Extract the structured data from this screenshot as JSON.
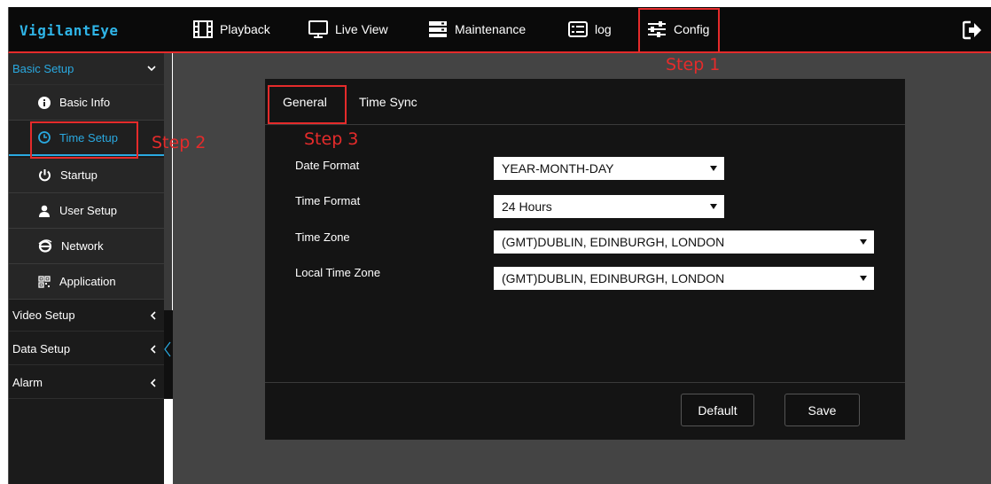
{
  "header": {
    "logo": "VigilantEye",
    "nav": [
      {
        "label": "Playback",
        "icon": "film-icon"
      },
      {
        "label": "Live View",
        "icon": "monitor-icon"
      },
      {
        "label": "Maintenance",
        "icon": "server-icon"
      },
      {
        "label": "log",
        "icon": "list-icon"
      },
      {
        "label": "Config",
        "icon": "sliders-icon"
      }
    ],
    "logout_icon": "logout-icon"
  },
  "sidebar": {
    "groups": [
      {
        "label": "Basic Setup",
        "expanded": true
      },
      {
        "label": "Video Setup",
        "expanded": false
      },
      {
        "label": "Data Setup",
        "expanded": false
      },
      {
        "label": "Alarm",
        "expanded": false
      }
    ],
    "items": [
      {
        "label": "Basic Info",
        "icon": "info-icon"
      },
      {
        "label": "Time Setup",
        "icon": "clock-icon",
        "selected": true
      },
      {
        "label": "Startup",
        "icon": "power-icon"
      },
      {
        "label": "User Setup",
        "icon": "user-icon"
      },
      {
        "label": "Network",
        "icon": "globe-icon"
      },
      {
        "label": "Application",
        "icon": "grid-icon"
      }
    ]
  },
  "tabs": [
    {
      "label": "General",
      "active": true
    },
    {
      "label": "Time Sync",
      "active": false
    }
  ],
  "form": {
    "date_format": {
      "label": "Date Format",
      "value": "YEAR-MONTH-DAY"
    },
    "time_format": {
      "label": "Time Format",
      "value": "24 Hours"
    },
    "time_zone": {
      "label": "Time Zone",
      "value": "(GMT)DUBLIN, EDINBURGH, LONDON"
    },
    "local_time_zone": {
      "label": "Local Time Zone",
      "value": "(GMT)DUBLIN, EDINBURGH, LONDON"
    }
  },
  "buttons": {
    "default": "Default",
    "save": "Save"
  },
  "annotations": {
    "step1": "Step 1",
    "step2": "Step 2",
    "step3": "Step 3"
  },
  "colors": {
    "accent": "#2aa9e0",
    "annotation": "#e52b2b",
    "logo": "#2fb5e8"
  }
}
